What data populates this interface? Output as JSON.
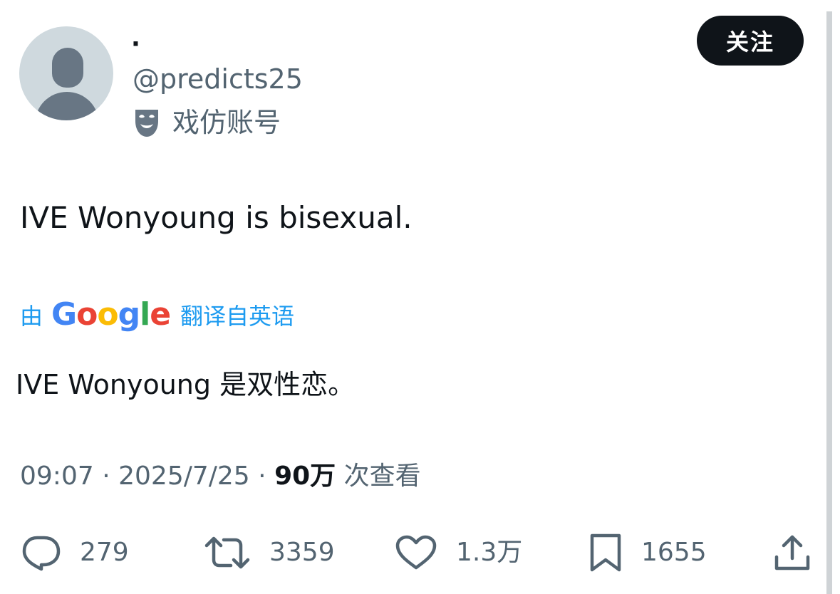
{
  "author": {
    "display_name": "·",
    "handle": "@predicts25",
    "label": "戏仿账号",
    "label_icon": "mask-icon"
  },
  "follow_button": {
    "label": "关注"
  },
  "tweet": {
    "text": "IVE Wonyoung is bisexual.",
    "translation": {
      "by_label": "由",
      "brand_letters": [
        "G",
        "o",
        "o",
        "g",
        "l",
        "e"
      ],
      "from_label": "翻译自英语",
      "text": "IVE Wonyoung 是双性恋。"
    },
    "meta": {
      "time": "09:07",
      "separator": "·",
      "date": "2025/7/25",
      "views_count": "90万",
      "views_label": "次查看"
    }
  },
  "actions": {
    "reply": {
      "icon": "reply-icon",
      "count": "279"
    },
    "retweet": {
      "icon": "retweet-icon",
      "count": "3359"
    },
    "like": {
      "icon": "heart-icon",
      "count": "1.3万"
    },
    "bookmark": {
      "icon": "bookmark-icon",
      "count": "1655"
    },
    "share": {
      "icon": "share-icon"
    }
  },
  "colors": {
    "text_primary": "#0f1419",
    "text_secondary": "#536471",
    "link_blue": "#1d9bf0",
    "follow_button_bg": "#0f1419",
    "avatar_bg": "#cfd9de",
    "avatar_figure": "#687684"
  }
}
